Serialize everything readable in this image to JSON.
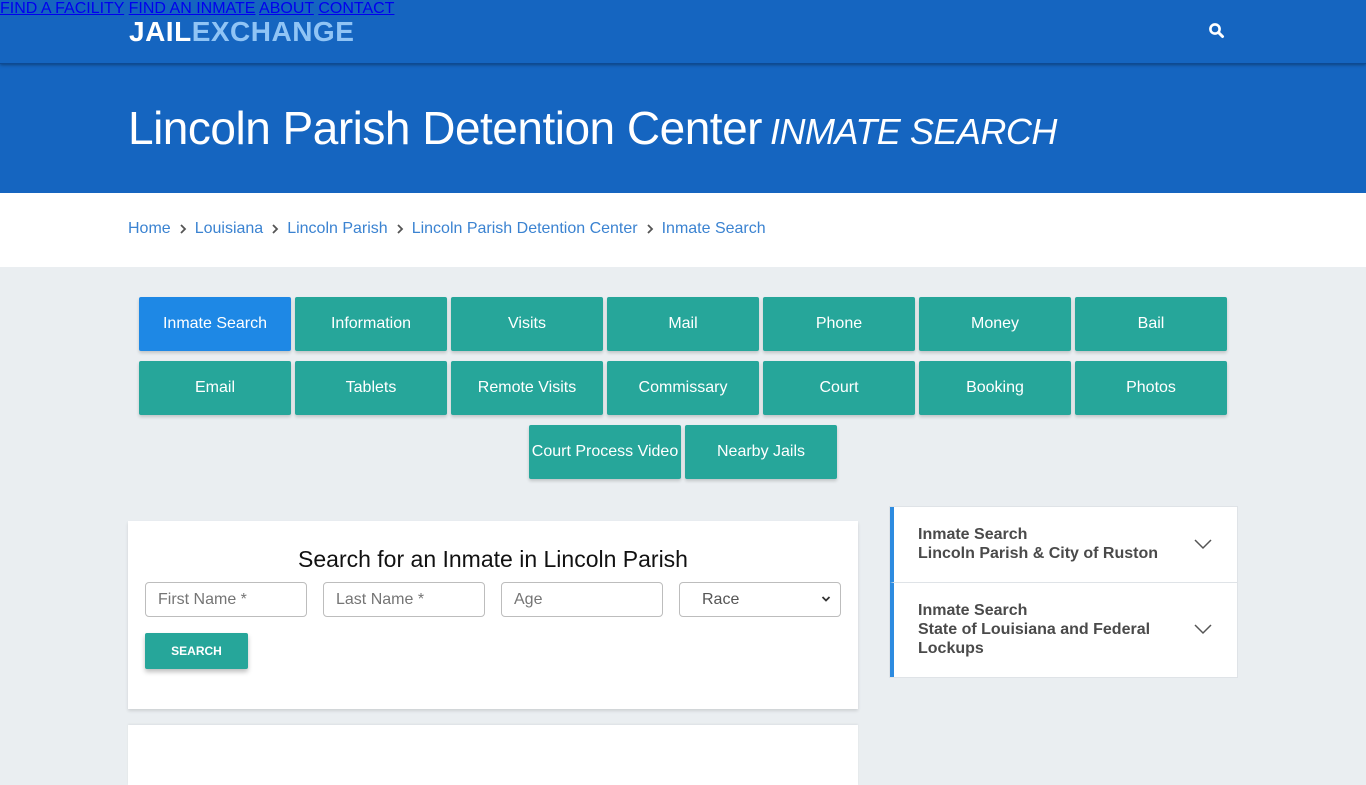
{
  "header": {
    "logo_part1": "JAIL",
    "logo_part2": "EXCHANGE",
    "nav": [
      {
        "label": "FIND A FACILITY"
      },
      {
        "label": "FIND AN INMATE"
      },
      {
        "label": "ABOUT"
      },
      {
        "label": "CONTACT"
      }
    ],
    "search_icon": "search-icon"
  },
  "hero": {
    "title": "Lincoln Parish Detention Center",
    "subtitle": "INMATE SEARCH"
  },
  "breadcrumb": [
    {
      "label": "Home"
    },
    {
      "label": "Louisiana"
    },
    {
      "label": "Lincoln Parish"
    },
    {
      "label": "Lincoln Parish Detention Center"
    },
    {
      "label": "Inmate Search"
    }
  ],
  "tabs": [
    {
      "label": "Inmate Search",
      "active": true
    },
    {
      "label": "Information"
    },
    {
      "label": "Visits"
    },
    {
      "label": "Mail"
    },
    {
      "label": "Phone"
    },
    {
      "label": "Money"
    },
    {
      "label": "Bail"
    },
    {
      "label": "Email"
    },
    {
      "label": "Tablets"
    },
    {
      "label": "Remote Visits"
    },
    {
      "label": "Commissary"
    },
    {
      "label": "Court"
    },
    {
      "label": "Booking"
    },
    {
      "label": "Photos"
    },
    {
      "label": "Court Process Video"
    },
    {
      "label": "Nearby Jails"
    }
  ],
  "search_form": {
    "title": "Search for an Inmate in Lincoln Parish",
    "first_name_placeholder": "First Name *",
    "last_name_placeholder": "Last Name *",
    "age_placeholder": "Age",
    "race_selected": "Race",
    "button_label": "SEARCH"
  },
  "sidebar": {
    "items": [
      {
        "line1": "Inmate Search",
        "line2": "Lincoln Parish & City of Ruston"
      },
      {
        "line1": "Inmate Search",
        "line2": "State of Louisiana and Federal Lockups"
      }
    ]
  },
  "colors": {
    "brand_blue": "#1565c0",
    "logo_light": "#90c4f5",
    "teal": "#26a69a",
    "active_tab": "#1e88e5",
    "link": "#3b83d1",
    "accent_border": "#2d8be0"
  }
}
